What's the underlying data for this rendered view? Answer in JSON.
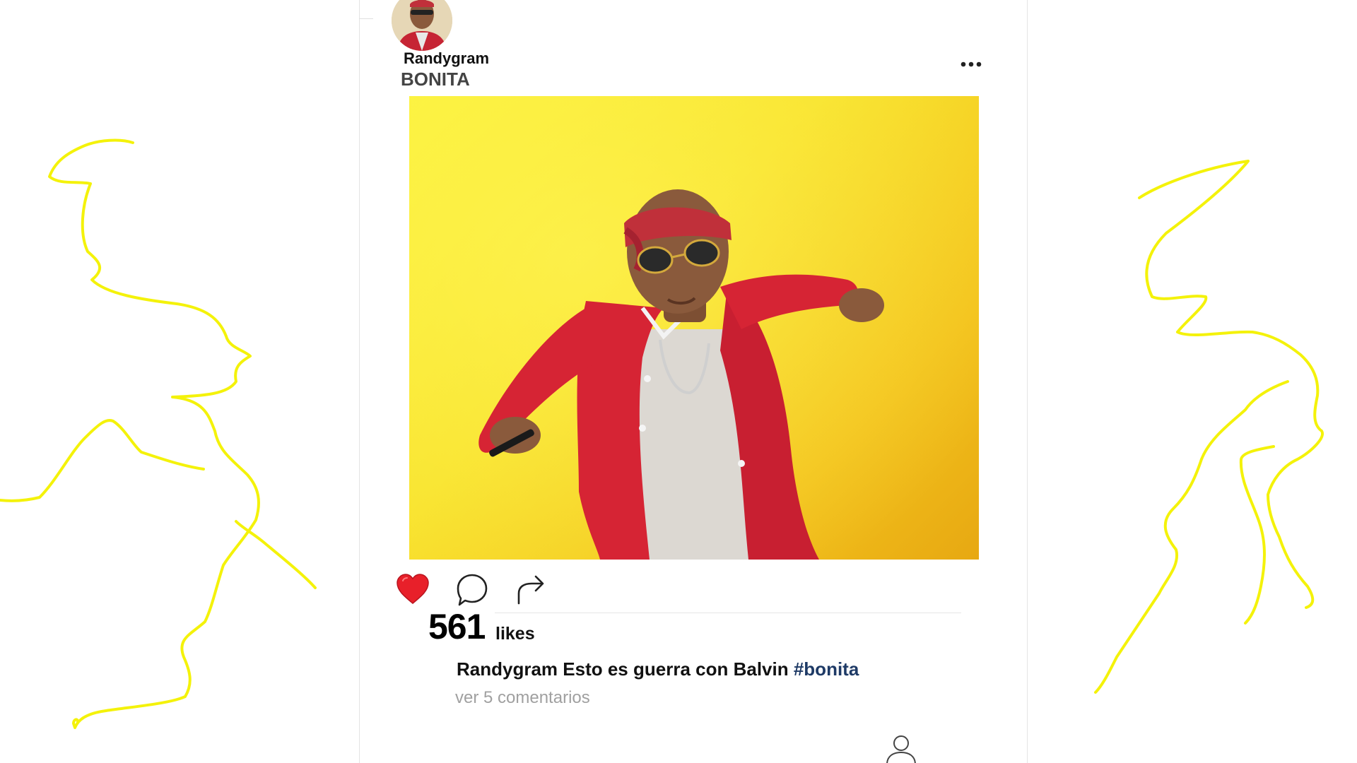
{
  "post": {
    "username": "Randygram",
    "subtitle": "BONITA",
    "more_icon": "more-horizontal-icon",
    "photo_description_icon": "post-photo",
    "likes_count": "561",
    "likes_label": "likes",
    "caption_user": "Randygram",
    "caption_text": "Esto es guerra con Balvin",
    "caption_hashtag": "#bonita",
    "comments_link": "ver 5 comentarios",
    "liked": true
  },
  "icons": {
    "like": "heart-icon",
    "comment": "comment-bubble-icon",
    "share": "share-arrow-icon",
    "profile": "user-profile-icon"
  },
  "colors": {
    "heart": "#e8202a",
    "doodle": "#f4f20a",
    "photo_bg_light": "#fbf23a",
    "photo_bg_dark": "#e7a812",
    "jacket": "#d62434",
    "hashtag": "#1e3a66",
    "muted_text": "#a0a0a0"
  }
}
